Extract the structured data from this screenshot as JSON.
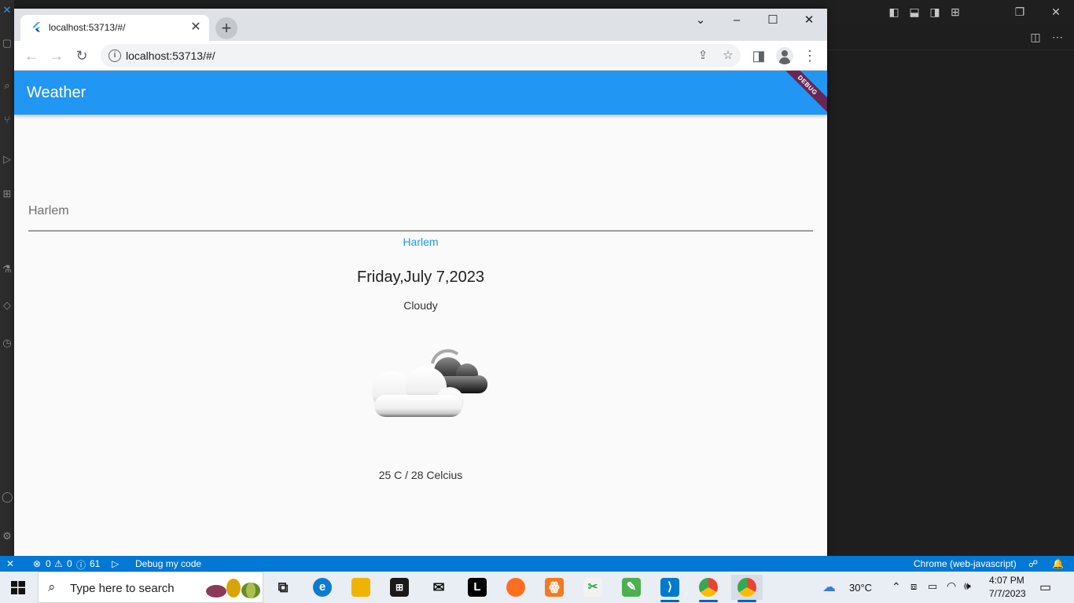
{
  "browser": {
    "tab_title": "localhost:53713/#/",
    "url": "localhost:53713/#/"
  },
  "app": {
    "title": "Weather",
    "debug_banner": "DEBUG",
    "search": {
      "value": "Harlem"
    },
    "city": "Harlem",
    "date": "Friday,July 7,2023",
    "condition": "Cloudy",
    "temperature": "25 C / 28 Celcius"
  },
  "statusbar": {
    "errors": "0",
    "warnings": "0",
    "info": "61",
    "debug_label": "Debug my code",
    "target": "Chrome (web-javascript)"
  },
  "taskbar": {
    "search_placeholder": "Type here to search",
    "weather_temp": "30°C",
    "time": "4:07 PM",
    "date": "7/7/2023",
    "apps": [
      {
        "name": "edge",
        "color": "#0c7bd0"
      },
      {
        "name": "file-explorer",
        "color": "#f0b400"
      },
      {
        "name": "store",
        "color": "#1a1a1a"
      },
      {
        "name": "mail",
        "color": "#1a1a1a"
      },
      {
        "name": "l-app",
        "color": "#000000"
      },
      {
        "name": "firefox",
        "color": "#ff6d1f"
      },
      {
        "name": "xampp",
        "color": "#f27b21"
      },
      {
        "name": "paint-app",
        "color": "#2ea84a"
      },
      {
        "name": "notepad-app",
        "color": "#4caf50"
      },
      {
        "name": "vscode",
        "color": "#007acc"
      },
      {
        "name": "chrome",
        "color": "#34a853"
      },
      {
        "name": "chrome",
        "color": "#34a853"
      }
    ]
  },
  "colors": {
    "appbar": "#2196f3",
    "accent_text": "#2196f3",
    "statusbar": "#0078d4"
  }
}
